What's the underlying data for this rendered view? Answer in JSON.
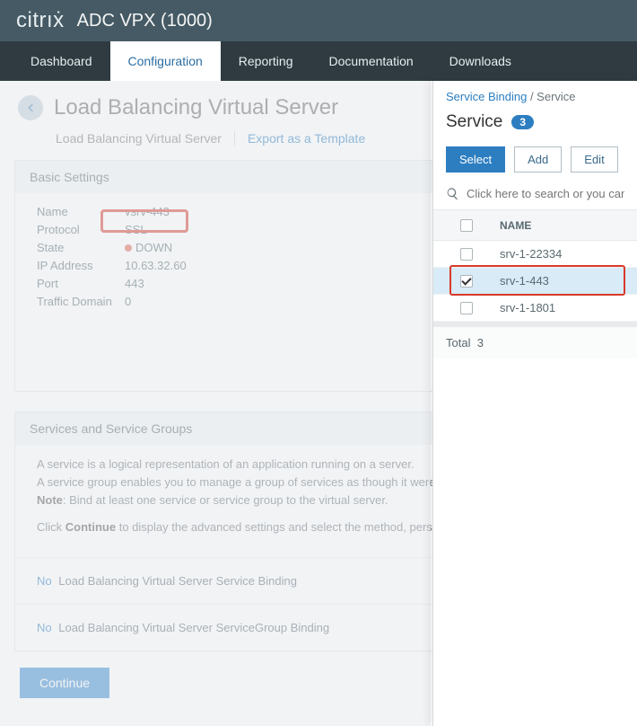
{
  "brand": {
    "citrix": "citrıẋ",
    "product": "ADC VPX (1000)"
  },
  "nav": {
    "dashboard": "Dashboard",
    "configuration": "Configuration",
    "reporting": "Reporting",
    "documentation": "Documentation",
    "downloads": "Downloads"
  },
  "page": {
    "title": "Load Balancing Virtual Server",
    "subtitle": "Load Balancing Virtual Server",
    "export": "Export as a Template"
  },
  "basic": {
    "heading": "Basic Settings",
    "name_k": "Name",
    "name_v": "vsrv-443",
    "protocol_k": "Protocol",
    "protocol_v": "SSL",
    "state_k": "State",
    "state_v": "DOWN",
    "ip_k": "IP Address",
    "ip_v": "10.63.32.60",
    "port_k": "Port",
    "port_v": "443",
    "td_k": "Traffic Domain",
    "td_v": "0"
  },
  "services_panel": {
    "heading": "Services and Service Groups",
    "desc1": "A service is a logical representation of an application running on a server.",
    "desc2": "A service group enables you to manage a group of services as though it were",
    "note_label": "Note",
    "note_text": ": Bind at least one service or service group to the virtual server.",
    "desc3a": "Click ",
    "desc3b": "Continue",
    "desc3c": " to display the advanced settings and select the method, pers",
    "link_no": "No",
    "link1": " Load Balancing Virtual Server Service Binding",
    "link2": " Load Balancing Virtual Server ServiceGroup Binding"
  },
  "continue": "Continue",
  "side": {
    "crumb_a": "Service Binding",
    "crumb_sep": " / ",
    "crumb_b": "Service",
    "title": "Service",
    "badge": "3",
    "select": "Select",
    "add": "Add",
    "edit": "Edit",
    "search_placeholder": "Click here to search or you can enter",
    "col_name": "NAME",
    "rows": [
      {
        "name": "srv-1-22334",
        "checked": false
      },
      {
        "name": "srv-1-443",
        "checked": true
      },
      {
        "name": "srv-1-1801",
        "checked": false
      }
    ],
    "total_label": "Total",
    "total": "3"
  }
}
